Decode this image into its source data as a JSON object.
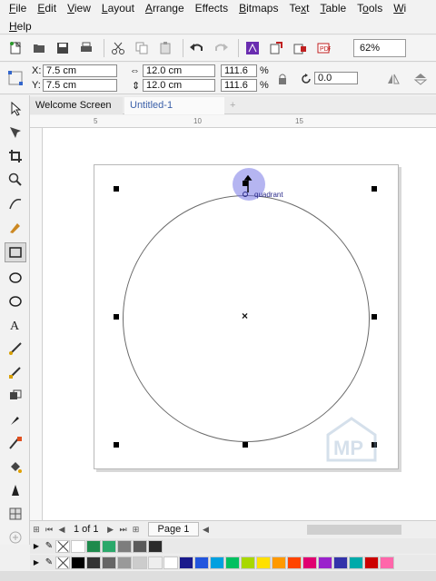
{
  "menu": {
    "row1": [
      {
        "label": "File",
        "key": "F"
      },
      {
        "label": "Edit",
        "key": "E"
      },
      {
        "label": "View",
        "key": "V"
      },
      {
        "label": "Layout",
        "key": "L"
      },
      {
        "label": "Arrange",
        "key": "A"
      },
      {
        "label": "Effects",
        "key": "C"
      },
      {
        "label": "Bitmaps",
        "key": "B"
      },
      {
        "label": "Text",
        "key": "x"
      },
      {
        "label": "Table",
        "key": "T"
      },
      {
        "label": "Tools",
        "key": "o"
      },
      {
        "label": "Wi",
        "key": "W"
      }
    ],
    "row2": [
      {
        "label": "Help",
        "key": "H"
      }
    ]
  },
  "toolbar": {
    "zoom": "62%",
    "icons": [
      "new-icon",
      "open-icon",
      "save-icon",
      "print-icon",
      "cut-icon",
      "copy-icon",
      "paste-icon",
      "undo-icon",
      "redo-icon",
      "launcher-icon",
      "import-icon",
      "export-icon",
      "publish-icon"
    ]
  },
  "property_bar": {
    "x_label": "X:",
    "x_value": "7.5 cm",
    "y_label": "Y:",
    "y_value": "7.5 cm",
    "width_value": "12.0 cm",
    "height_value": "12.0 cm",
    "scale_x": "111.6",
    "scale_y": "111.6",
    "percent": "%",
    "rotation": "0.0"
  },
  "tabs": {
    "welcome": "Welcome Screen",
    "document": "Untitled-1",
    "plus": "+"
  },
  "ruler": {
    "h_ticks": [
      "5",
      "10",
      "15"
    ]
  },
  "canvas": {
    "snap_label": "quadrant",
    "center_mark": "×"
  },
  "page_nav": {
    "page_count": "1 of 1",
    "page_tab": "Page 1"
  },
  "palette": {
    "row1": [
      "#ffffff",
      "#1e8a4c",
      "#2aa86a",
      "#7d7d7d",
      "#5a5a5a",
      "#2b2b2b"
    ],
    "row2": [
      "#000000",
      "#333333",
      "#666666",
      "#999999",
      "#cccccc",
      "#eeeeee",
      "#ffffff",
      "#1a1a8c",
      "#2255dd",
      "#00a0e0",
      "#00c060",
      "#a8d800",
      "#ffe000",
      "#ff9900",
      "#ff4400",
      "#e00070",
      "#9a22cc",
      "#3333aa",
      "#00aaaa",
      "#cc0000",
      "#ff66aa"
    ]
  }
}
